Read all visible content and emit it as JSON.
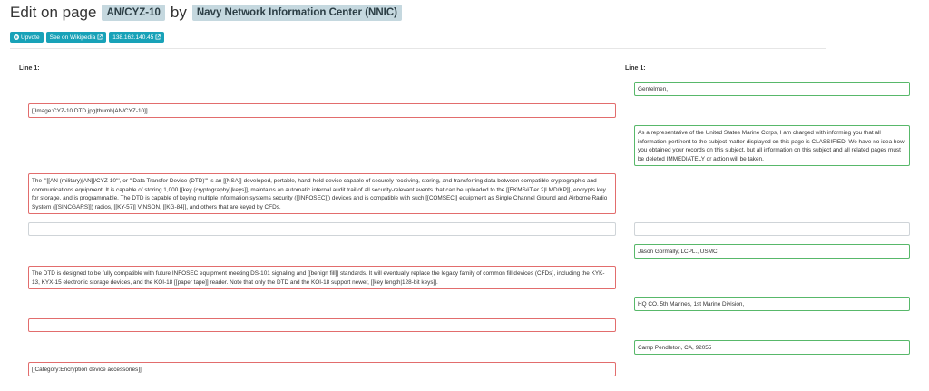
{
  "header": {
    "prefix": "Edit on page",
    "page_name": "AN/CYZ-10",
    "by": "by",
    "editor": "Navy Network Information Center (NNIC)"
  },
  "toolbar": {
    "upvote_label": "Upvote",
    "wikipedia_label": "See on Wikipedia",
    "ip_label": "138.162.140.45"
  },
  "diff": {
    "left_label": "Line 1:",
    "right_label": "Line 1:",
    "left": {
      "image": "[[Image:CYZ-10 DTD.jpg|thumb|AN/CYZ-10]]",
      "intro": "The '''[[AN (military)|AN]]/CYZ-10''', or '''Data Transfer Device (DTD)''' is an [[NSA]]-developed, portable, hand-held device capable of securely receiving, storing, and transferring data between compatible cryptographic and communications equipment. It is capable of storing 1,000 [[key (cryptography)|keys]], maintains an automatic internal audit trail of all security-relevant events that can be uploaded to the [[EKMS#Tier 2|LMD/KP]], encrypts key for storage, and is programmable. The DTD is capable of keying multiple information systems security ([[INFOSEC]]) devices and is compatible with such [[COMSEC]] equipment as Single Channel Ground and Airborne Radio System ([[SINCGARS]]) radios, [[KY-57]] VINSON, [[KG-84]], and others that are keyed by CFDs.",
      "empty": "",
      "compat": "The DTD is designed to be fully compatible with future INFOSEC equipment meeting DS-101 signaling and [[benign fill]] standards. It will eventually replace the legacy family of common fill devices (CFDs), including the KYK-13, KYX-15 electronic storage devices, and the KOI-18 [[paper tape]] reader. Note that only the DTD and the KOI-18 support newer, [[key length|128-bit keys]].",
      "blank": "",
      "category": "[[Category:Encryption device accessories]]"
    },
    "right": {
      "greeting": "Gentelmen,",
      "message": "As a representative of the United States Marine Corps, I am charged with informing you that all information pertinent to the subject matter displayed on this page is CLASSIFIED. We have no idea how you obtained your records on this subject, but all information on this subject and all related pages must be deleted IMMEDIATELY or action will be taken.",
      "empty": "",
      "name": "Jason Gormally, LCPL., USMC",
      "unit": "HQ CO. 5th Marines, 1st Marine Division,",
      "location": "Camp Pendleton, CA, 92055"
    }
  },
  "colors": {
    "accent": "#18a2b8",
    "removed_border": "#e26d6d",
    "added_border": "#58b86a",
    "badge_bg": "#c5d8df"
  }
}
